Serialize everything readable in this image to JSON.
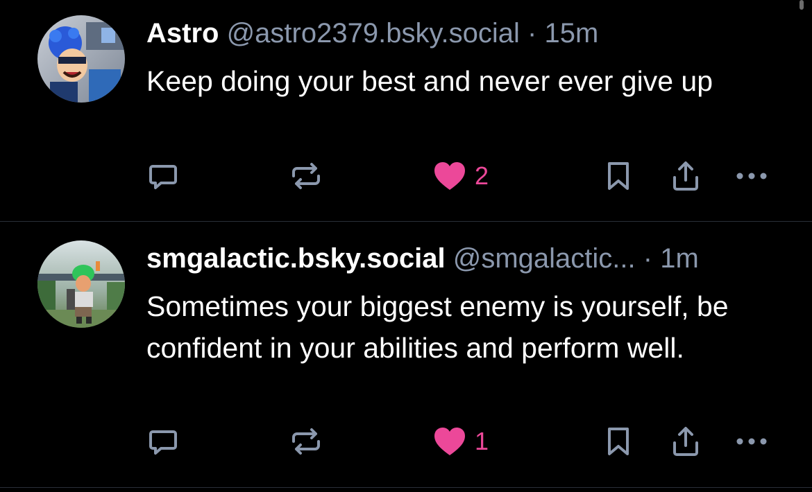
{
  "posts": [
    {
      "author": "Astro",
      "handle": "@astro2379.bsky.social",
      "separator": "·",
      "time": "15m",
      "text": "Keep doing your best and never ever give up",
      "likes": "2",
      "liked": true
    },
    {
      "author": "smgalactic.bsky.social",
      "handle": "@smgalactic...",
      "separator": "·",
      "time": "1m",
      "text": "Sometimes your biggest enemy is yourself, be confident in your abilities and perform well.",
      "likes": "1",
      "liked": true
    }
  ],
  "colors": {
    "background": "#000000",
    "text": "#ffffff",
    "secondary": "#8b98ad",
    "like": "#ec4899",
    "divider": "#2a2f38"
  },
  "icons": [
    "reply-icon",
    "repost-icon",
    "heart-icon",
    "bookmark-icon",
    "share-icon",
    "more-icon"
  ]
}
